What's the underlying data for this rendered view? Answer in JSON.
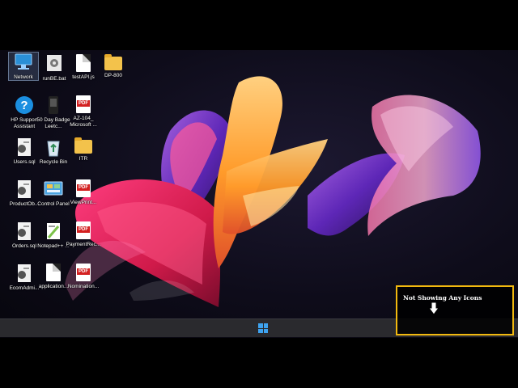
{
  "desktop": {
    "icons": [
      {
        "label": "Network",
        "icon": "network-icon"
      },
      {
        "label": "runBE.bat",
        "icon": "gear-file-icon"
      },
      {
        "label": "testAPI.js",
        "icon": "file-icon"
      },
      {
        "label": "DP-800",
        "icon": "folder-icon"
      },
      {
        "label": "HP Support Assistant",
        "icon": "hp-support-icon"
      },
      {
        "label": "50 Day Badge Leetc...",
        "icon": "badge-icon"
      },
      {
        "label": "AZ-104_ Microsoft ...",
        "icon": "pdf-icon",
        "badge": "PDF"
      },
      {
        "label": "Users.sql",
        "icon": "sql-file-icon"
      },
      {
        "label": "Recycle Bin",
        "icon": "recycle-bin-icon"
      },
      {
        "label": "ITR",
        "icon": "folder-icon"
      },
      {
        "label": "ProductOb...",
        "icon": "sql-file-icon"
      },
      {
        "label": "Control Panel",
        "icon": "control-panel-icon"
      },
      {
        "label": "ViewPrint...",
        "icon": "pdf-icon",
        "badge": "PDF"
      },
      {
        "label": "Orders.sql",
        "icon": "sql-file-icon"
      },
      {
        "label": "Notepad++ ...",
        "icon": "notepad-icon"
      },
      {
        "label": "PaymentRec...",
        "icon": "pdf-icon",
        "badge": "PDF"
      },
      {
        "label": "EcomAdmi...",
        "icon": "sql-file-icon"
      },
      {
        "label": "application...",
        "icon": "file-icon"
      },
      {
        "label": "Nomination...",
        "icon": "pdf-icon",
        "badge": "PDF"
      }
    ]
  },
  "annotation": {
    "text": "Not Showing Any Icons",
    "border_color": "#f2b90f"
  },
  "taskbar": {
    "start_icon": "windows-start-icon",
    "accent": "#3ea3f0"
  }
}
